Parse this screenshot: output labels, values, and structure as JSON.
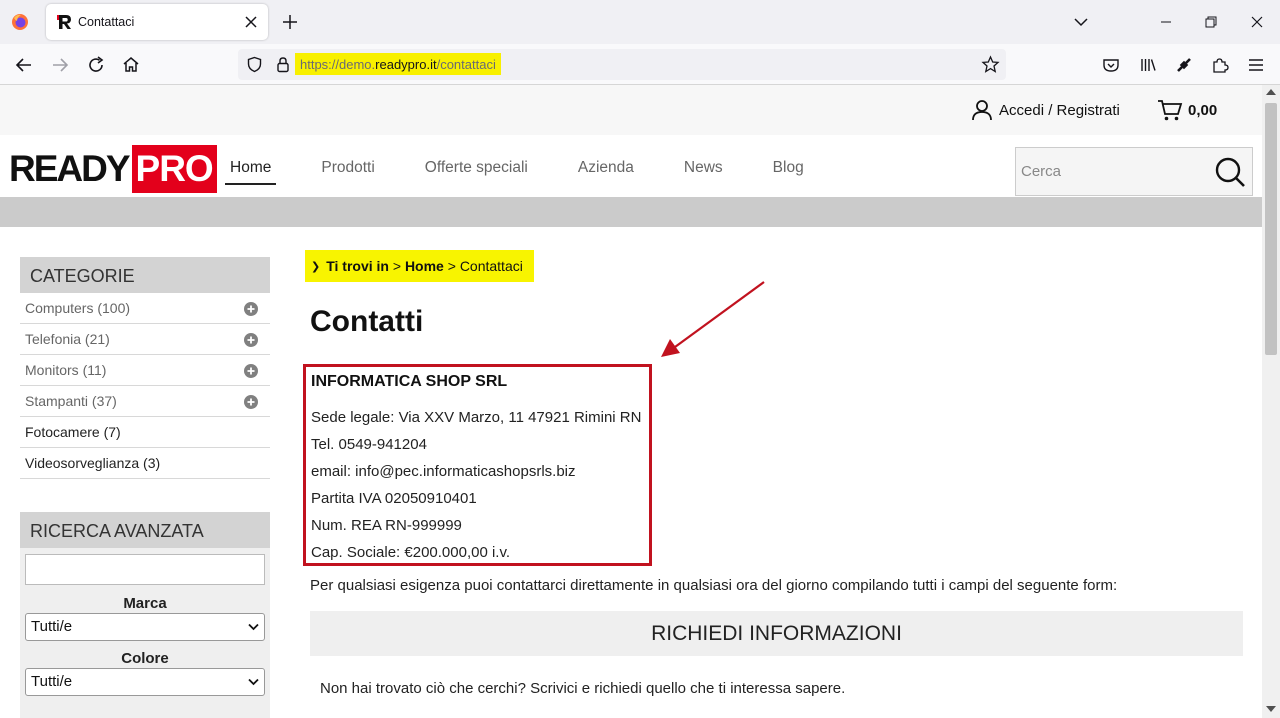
{
  "browser": {
    "tab_title": "Contattaci",
    "url_prefix": "https://demo.",
    "url_domain": "readypro.it",
    "url_path": "/contattaci"
  },
  "topbar": {
    "account_label": "Accedi / Registrati",
    "cart_total": "0,00"
  },
  "logo": {
    "part1": "READY",
    "part2": "PRO"
  },
  "menu": [
    {
      "label": "Home",
      "active": true
    },
    {
      "label": "Prodotti"
    },
    {
      "label": "Offerte speciali"
    },
    {
      "label": "Azienda"
    },
    {
      "label": "News"
    },
    {
      "label": "Blog"
    }
  ],
  "search": {
    "placeholder": "Cerca"
  },
  "sidebar": {
    "categories_title": "CATEGORIE",
    "categories": [
      {
        "label": "Computers (100)",
        "expandable": true
      },
      {
        "label": "Telefonia (21)",
        "expandable": true
      },
      {
        "label": "Monitors (11)",
        "expandable": true
      },
      {
        "label": "Stampanti (37)",
        "expandable": true
      },
      {
        "label": "Fotocamere (7)",
        "expandable": false
      },
      {
        "label": "Videosorveglianza (3)",
        "expandable": false
      }
    ],
    "advanced_title": "RICERCA AVANZATA",
    "brand_label": "Marca",
    "brand_value": "Tutti/e",
    "color_label": "Colore",
    "color_value": "Tutti/e"
  },
  "breadcrumb": {
    "prefix": "Ti trovi in",
    "sep1": ">",
    "home": "Home",
    "sep2": ">",
    "current": "Contattaci"
  },
  "page": {
    "title": "Contatti",
    "company": "INFORMATICA SHOP SRL",
    "lines": [
      "Sede legale: Via XXV Marzo, 11 47921 Rimini RN",
      "Tel. 0549-941204",
      "email: info@pec.informaticashopsrls.biz",
      "Partita IVA 02050910401",
      "Num. REA RN-999999",
      "Cap. Sociale: €200.000,00 i.v."
    ],
    "intro": "Per qualsiasi esigenza puoi contattarci direttamente in qualsiasi ora del giorno compilando tutti i campi del seguente form:",
    "request_heading": "RICHIEDI INFORMAZIONI",
    "request_text": "Non hai trovato ciò che cerchi? Scrivici e richiedi quello che ti interessa sapere."
  },
  "colors": {
    "highlight": "#f8f400",
    "brand_red": "#e3001b",
    "annotation_red": "#c1121f"
  }
}
